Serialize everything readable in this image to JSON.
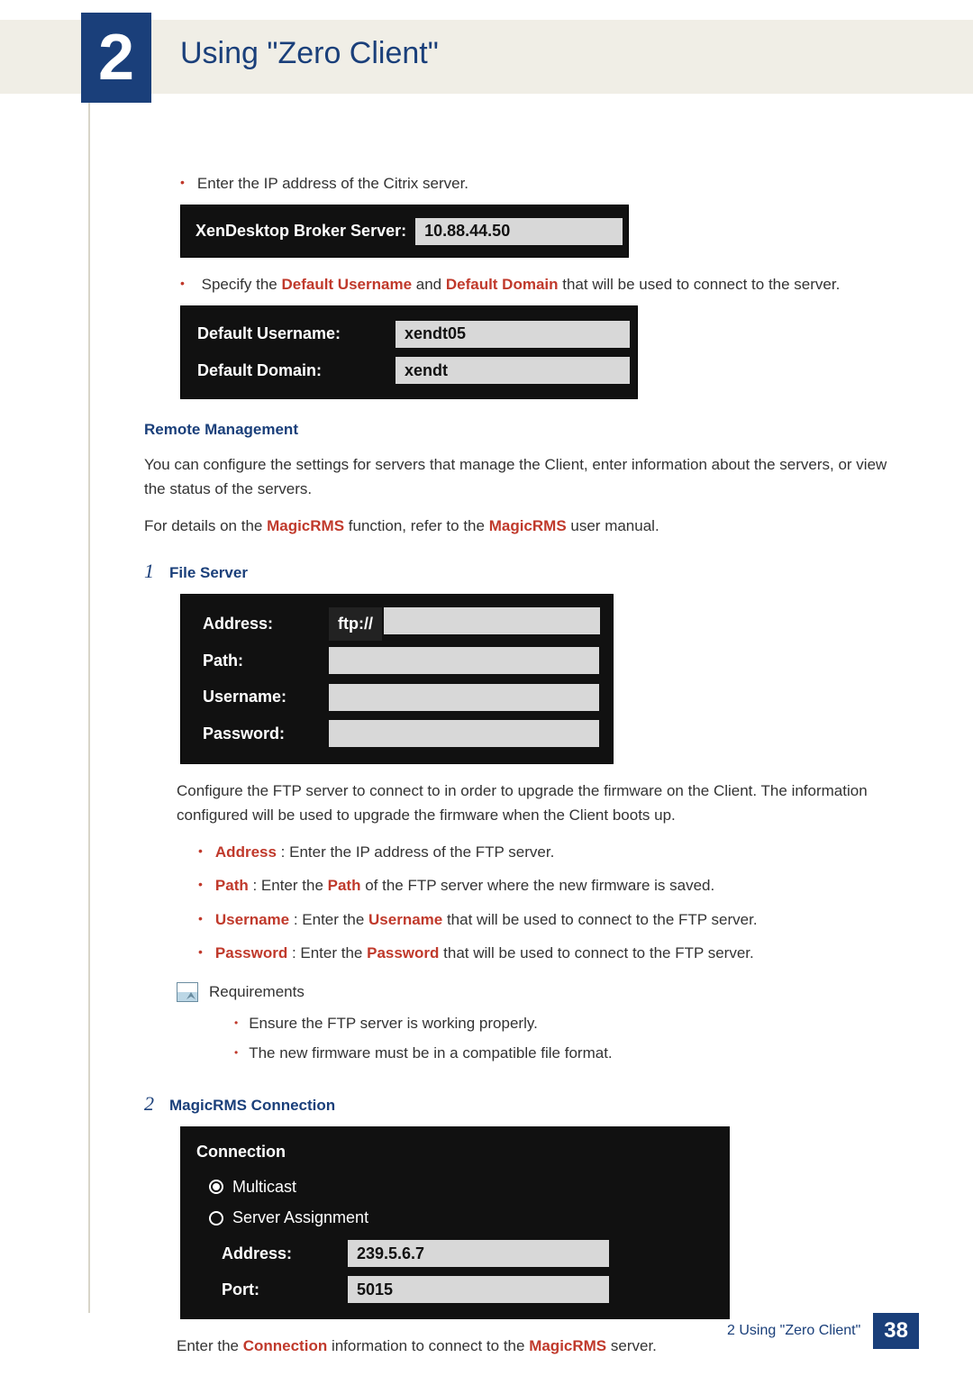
{
  "chapter": {
    "number": "2",
    "title": "Using \"Zero Client\""
  },
  "step_ip": "Enter the IP address of the Citrix server.",
  "broker": {
    "label": "XenDesktop Broker Server:",
    "value": "10.88.44.50"
  },
  "step_defaults": {
    "prefix": "Specify the ",
    "bold1": "Default Username",
    "mid": " and ",
    "bold2": "Default Domain",
    "suffix": " that will be used to connect to the server."
  },
  "defaults": {
    "username_label": "Default Username:",
    "username_value": "xendt05",
    "domain_label": "Default Domain:",
    "domain_value": "xendt"
  },
  "remote": {
    "heading": "Remote Management",
    "para1": "You can configure the settings for servers that manage the Client, enter information about the servers, or view the status of the servers.",
    "para2_a": "For details on the ",
    "para2_b": "MagicRMS",
    "para2_c": " function, refer to the ",
    "para2_d": "MagicRMS",
    "para2_e": " user manual."
  },
  "fileserver": {
    "num": "1",
    "title": "File Server",
    "labels": {
      "address": "Address:",
      "path": "Path:",
      "username": "Username:",
      "password": "Password:"
    },
    "scheme": "ftp://",
    "desc": "Configure the FTP server to connect to in order to upgrade the firmware on the Client. The information configured will be used to upgrade the firmware when the Client boots up.",
    "bullets": {
      "address": {
        "k": "Address",
        "v": " : Enter the IP address of the FTP server."
      },
      "path": {
        "k": "Path",
        "mid": " : Enter the ",
        "k2": "Path",
        "v": " of the FTP server where the new firmware is saved."
      },
      "username": {
        "k": "Username",
        "mid": " : Enter the ",
        "k2": "Username",
        "v": " that will be used to connect to the FTP server."
      },
      "password": {
        "k": "Password",
        "mid": " : Enter the ",
        "k2": "Password",
        "v": " that will be used to connect to the FTP server."
      }
    },
    "req_title": "Requirements",
    "req1": "Ensure the FTP server is working properly.",
    "req2": "The new firmware must be in a compatible file format."
  },
  "magicrms": {
    "num": "2",
    "title": "MagicRMS Connection",
    "panel_title": "Connection",
    "opt_multicast": "Multicast",
    "opt_server": "Server Assignment",
    "address_label": "Address:",
    "address_value": "239.5.6.7",
    "port_label": "Port:",
    "port_value": "5015",
    "desc_a": "Enter the ",
    "desc_b": "Connection",
    "desc_c": " information to connect to the ",
    "desc_d": "MagicRMS",
    "desc_e": " server."
  },
  "footer": {
    "text": "2 Using \"Zero Client\"",
    "page": "38"
  }
}
